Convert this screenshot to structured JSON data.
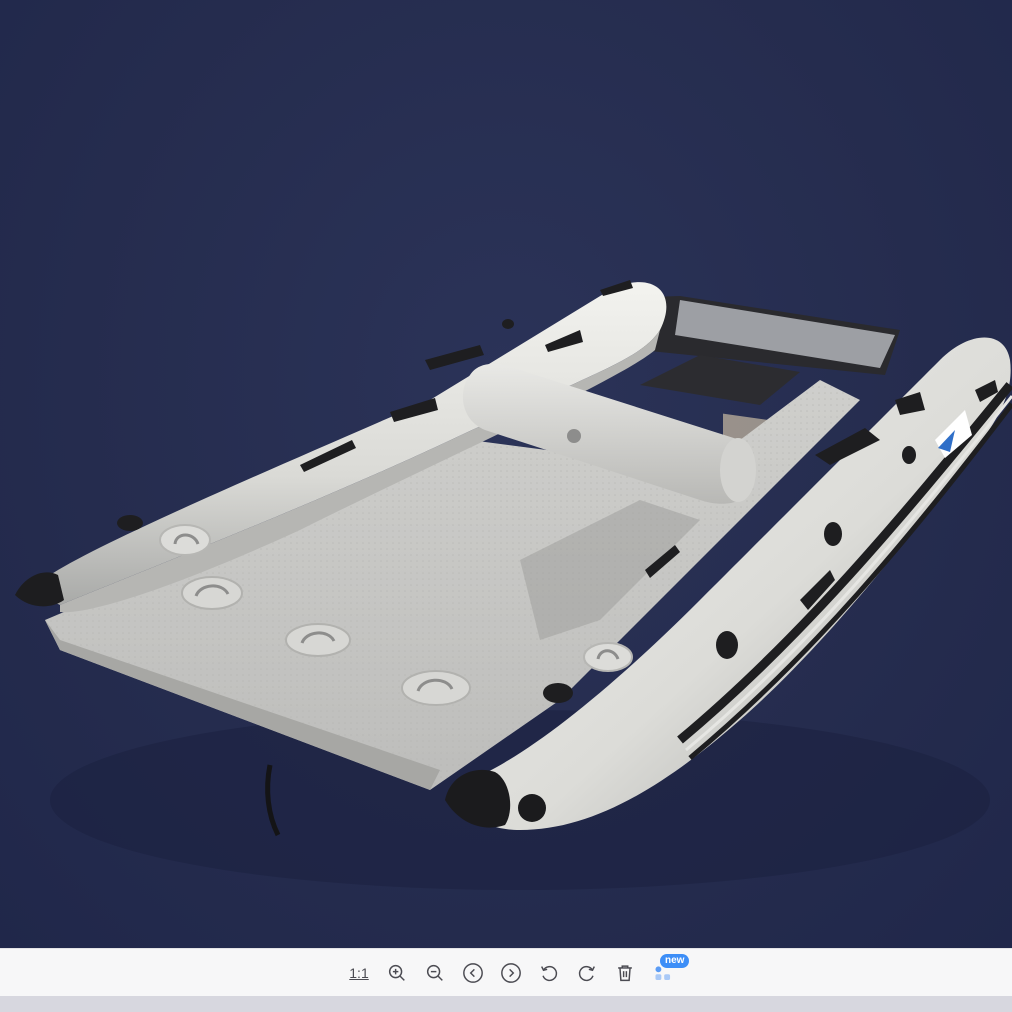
{
  "toolbar": {
    "actual_size_label": "1:1",
    "apps_badge": "new",
    "buttons": [
      {
        "icon": "zoom-in-icon"
      },
      {
        "icon": "zoom-out-icon"
      },
      {
        "icon": "previous-icon"
      },
      {
        "icon": "next-icon"
      },
      {
        "icon": "rotate-left-icon"
      },
      {
        "icon": "rotate-right-icon"
      },
      {
        "icon": "delete-icon"
      },
      {
        "icon": "apps-icon"
      }
    ]
  },
  "colors": {
    "background": "#252c4e",
    "toolbar": "#f7f7f8",
    "accent": "#3d8ef7"
  }
}
